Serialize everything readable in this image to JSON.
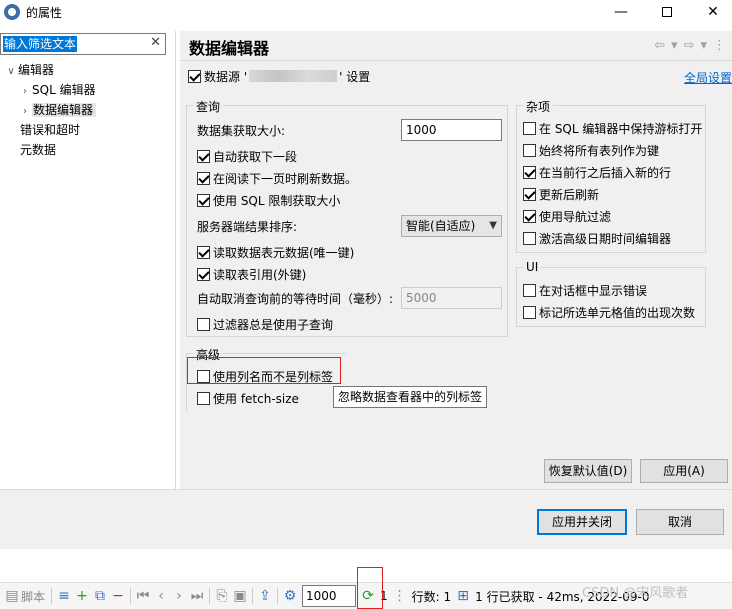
{
  "window": {
    "title": "的属性",
    "minimize": "—",
    "maximize": "",
    "close": "✕"
  },
  "left": {
    "filter_placeholder": "输入筛选文本",
    "filter_clear": "✕",
    "tree": [
      {
        "label": "编辑器",
        "arrow": "∨"
      },
      {
        "label": "SQL 编辑器",
        "arrow": "›"
      },
      {
        "label": "数据编辑器",
        "arrow": "›"
      },
      {
        "label": "错误和超时"
      },
      {
        "label": "元数据"
      }
    ]
  },
  "right": {
    "title": "数据编辑器",
    "nav": [
      "⇦",
      "▾",
      "⇨",
      "▾",
      "⋮"
    ],
    "datasource_prefix": "数据源 '",
    "datasource_suffix": "' 设置",
    "global_settings": "全局设置",
    "query": {
      "label": "查询",
      "fetch_size_label": "数据集获取大小:",
      "fetch_size_value": "1000",
      "auto_fetch_next": "自动获取下一段",
      "refresh_on_next": "在阅读下一页时刷新数据。",
      "use_sql_limit": "使用 SQL 限制获取大小",
      "server_sort_label": "服务器端结果排序:",
      "server_sort_value": "智能(自适应)",
      "read_metadata": "读取数据表元数据(唯一键)",
      "read_references": "读取表引用(外键)",
      "auto_cancel_label": "自动取消查询前的等待时间（毫秒）:",
      "auto_cancel_value": "5000",
      "filter_subquery": "过滤器总是使用子查询"
    },
    "misc": {
      "label": "杂项",
      "keep_cursor": "在 SQL 编辑器中保持游标打开",
      "all_columns_keys": "始终将所有表列作为键",
      "insert_after_current": "在当前行之后插入新的行",
      "refresh_after_update": "更新后刷新",
      "nav_filter": "使用导航过滤",
      "advanced_datetime": "激活高级日期时间编辑器"
    },
    "ui": {
      "label": "UI",
      "show_errors": "在对话框中显示错误",
      "mark_occurrences": "标记所选单元格值的出现次数"
    },
    "advanced": {
      "label": "高级",
      "use_column_names": "使用列名而不是列标签",
      "use_fetch_size": "使用 fetch-size",
      "tooltip": "忽略数据查看器中的列标签"
    },
    "restore_defaults": "恢复默认值(D)",
    "apply": "应用(A)"
  },
  "footer": {
    "apply_close": "应用并关闭",
    "cancel": "取消"
  },
  "toolbar": {
    "script": "脚本",
    "fetch_value": "1000",
    "count_one": "1",
    "rows_label": "行数: 1",
    "status": "1 行已获取 - 42ms, 2022-09-0",
    "watermark": "CSDN @宋风歌者"
  },
  "colors": {
    "accent": "#0078d7",
    "link": "#0066cc",
    "highlight_box": "#e02020"
  }
}
